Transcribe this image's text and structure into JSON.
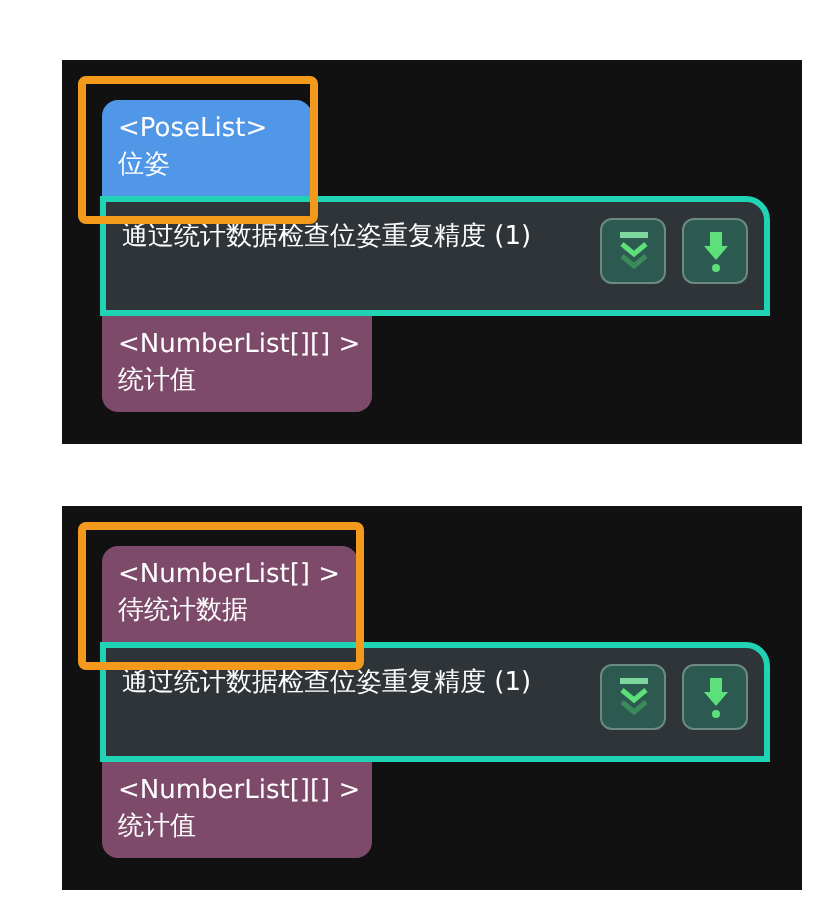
{
  "panels": [
    {
      "input_port": {
        "type_label": "<PoseList>",
        "name": "位姿",
        "color": "#5097e8",
        "highlighted": true
      },
      "node": {
        "title": "通过统计数据检查位姿重复精度 (1)"
      },
      "output_port": {
        "type_label": "<NumberList[][] >",
        "name": "统计值",
        "color": "#7d4a69",
        "highlighted": false
      }
    },
    {
      "input_port": {
        "type_label": "<NumberList[] >",
        "name": "待统计数据",
        "color": "#7d4a69",
        "highlighted": true
      },
      "node": {
        "title": "通过统计数据检查位姿重复精度 (1)"
      },
      "output_port": {
        "type_label": "<NumberList[][] >",
        "name": "统计值",
        "color": "#7d4a69",
        "highlighted": false
      }
    }
  ]
}
